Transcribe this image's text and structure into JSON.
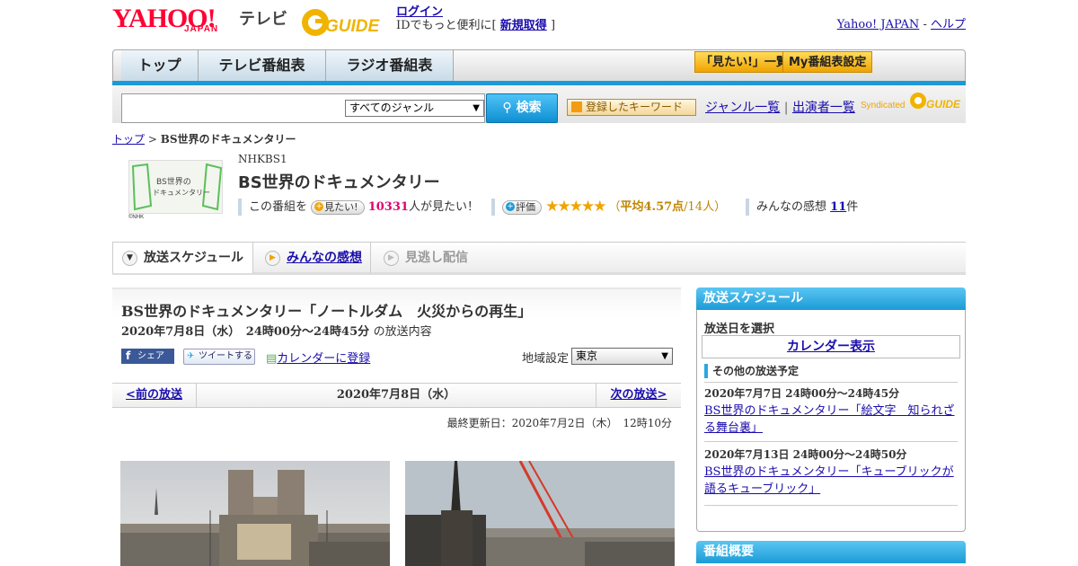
{
  "header": {
    "yahoo": "YAHOO!",
    "japan": "JAPAN",
    "tv": "テレビ",
    "gguide": "GUIDE",
    "login": "ログイン",
    "login_sub_prefix": "IDでもっと便利に[",
    "register": "新規取得",
    "login_sub_suffix": "]",
    "yahoo_japan": "Yahoo! JAPAN",
    "sep": " - ",
    "help": "ヘルプ"
  },
  "nav": {
    "tabs": [
      "トップ",
      "テレビ番組表",
      "ラジオ番組表"
    ],
    "mitai": "「見たい!」一覧",
    "my": "My番組表設定"
  },
  "search": {
    "genre": "すべてのジャンル",
    "button": "検索",
    "keyword": "登録したキーワード",
    "genre_list": "ジャンル一覧",
    "divider": "|",
    "cast_list": "出演者一覧",
    "syndicated": "Syndicated"
  },
  "breadcrumb": {
    "top": "トップ",
    "sep": " > ",
    "current": "BS世界のドキュメンタリー"
  },
  "program": {
    "thumb_text": "BS世界の ドキュメンタリー",
    "thumb_credit": "©NHK",
    "channel": "NHKBS1",
    "title": "BS世界のドキュメンタリー",
    "want_prefix": "この番組を",
    "want_button": "見たい!",
    "want_count": "10331",
    "want_suffix": "人が見たい！",
    "rate_button": "評価",
    "rating": 4.57,
    "rating_text": "（平均4.57点/14人）",
    "rating_open": "（",
    "rating_avg": "平均4.57点",
    "rating_rest": "/14人）",
    "impressions_prefix": "みんなの感想",
    "impressions_count": "11",
    "impressions_suffix": "件"
  },
  "tabs": [
    {
      "label": "放送スケジュール",
      "active": true
    },
    {
      "label": "みんなの感想",
      "active": false
    },
    {
      "label": "見逃し配信",
      "active": false
    }
  ],
  "episode": {
    "title": "BS世界のドキュメンタリー「ノートルダム　火災からの再生」",
    "date": "2020年7月8日（水）　24時00分～24時45分",
    "date_suffix": "の放送内容",
    "share": "シェア",
    "tweet": "ツイートする",
    "calendar": "カレンダーに登録",
    "region_label": "地域設定",
    "region": "東京"
  },
  "pager": {
    "prev": "<前の放送",
    "current": "2020年7月8日（水）",
    "next": "次の放送>"
  },
  "updated": "最終更新日：2020年7月2日（木）　12時10分",
  "sidebar": {
    "schedule_title": "放送スケジュール",
    "select_date": "放送日を選択",
    "calendar": "カレンダー表示",
    "other": "その他の放送予定",
    "schedules": [
      {
        "date": "2020年7月7日 24時00分～24時45分",
        "title": "BS世界のドキュメンタリー「絵文字　知られざる舞台裏」"
      },
      {
        "date": "2020年7月13日 24時00分～24時50分",
        "title": "BS世界のドキュメンタリー「キューブリックが語るキューブリック」"
      }
    ],
    "overview_title": "番組概要"
  },
  "colors": {
    "accent_blue": "#1a9ad8",
    "orange": "#f0a400",
    "link": "#1a0dab",
    "red": "#ff0033"
  }
}
